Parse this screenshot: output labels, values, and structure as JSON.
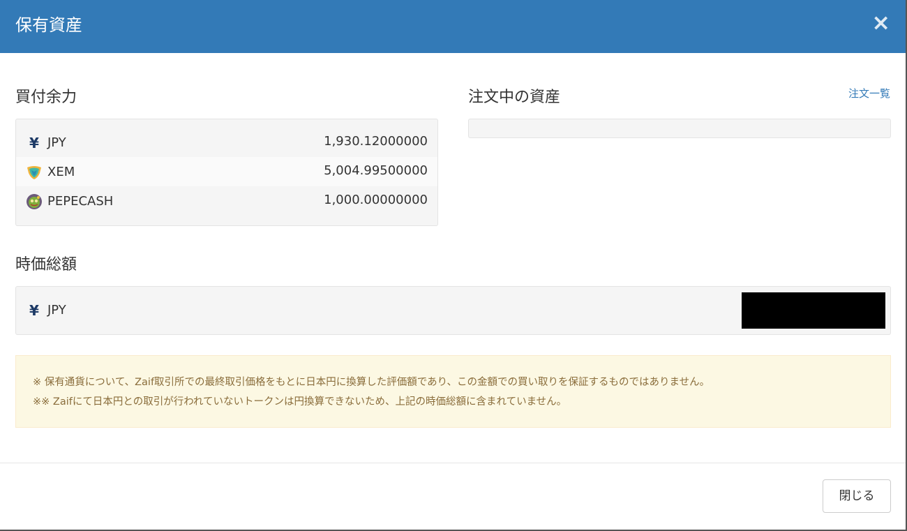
{
  "header": {
    "title": "保有資産",
    "close_symbol": "×",
    "background": "#337ab7"
  },
  "buying_power": {
    "title": "買付余力",
    "assets": [
      {
        "icon": "yen-icon",
        "symbol": "¥",
        "code": "JPY",
        "amount": "1,930.12000000"
      },
      {
        "icon": "xem-icon",
        "code": "XEM",
        "amount": "5,004.99500000"
      },
      {
        "icon": "pepecash-icon",
        "code": "PEPECASH",
        "amount": "1,000.00000000"
      }
    ]
  },
  "ordering_assets": {
    "title": "注文中の資産",
    "link_label": "注文一覧"
  },
  "market_value": {
    "title": "時価総額",
    "symbol": "¥",
    "code": "JPY"
  },
  "notice": {
    "line1": "※ 保有通貨について、Zaif取引所での最終取引価格をもとに日本円に換算した評価額であり、この金額での買い取りを保証するものではありません。",
    "line2": "※※ Zaifにて日本円との取引が行われていないトークンは円換算できないため、上記の時価総額に含まれていません。"
  },
  "footer": {
    "close_button_label": "閉じる"
  }
}
